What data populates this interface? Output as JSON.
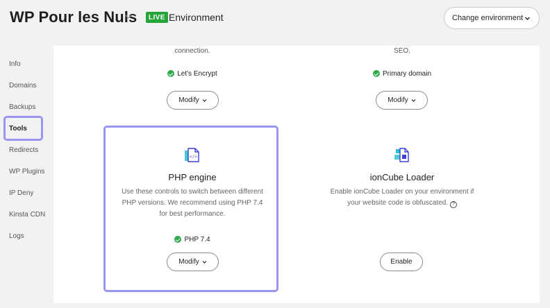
{
  "header": {
    "site_title": "WP Pour les Nuls",
    "live_badge": "LIVE",
    "environment_label": "Environment",
    "change_environment_label": "Change environment"
  },
  "sidebar": {
    "items": [
      {
        "label": "Info"
      },
      {
        "label": "Domains"
      },
      {
        "label": "Backups"
      },
      {
        "label": "Tools",
        "active": true
      },
      {
        "label": "Redirects"
      },
      {
        "label": "WP Plugins"
      },
      {
        "label": "IP Deny"
      },
      {
        "label": "Kinsta CDN"
      },
      {
        "label": "Logs"
      }
    ]
  },
  "tools": {
    "ssl": {
      "desc_tail": "connection.",
      "status": "Let's Encrypt",
      "button": "Modify"
    },
    "domain": {
      "desc_tail": "SEO.",
      "status": "Primary domain",
      "button": "Modify"
    },
    "php": {
      "icon": "php-engine-icon",
      "title": "PHP engine",
      "desc_lines": [
        "Use these controls to switch between different",
        "PHP versions. We recommend using PHP 7.4",
        "for best performance."
      ],
      "status": "PHP 7.4",
      "button": "Modify"
    },
    "ioncube": {
      "icon": "ioncube-icon",
      "title": "ionCube Loader",
      "desc_lines": [
        "Enable ionCube Loader on your environment if",
        "your website code is obfuscated."
      ],
      "button": "Enable"
    }
  },
  "colors": {
    "live_green": "#23a537",
    "check_green": "#2eaa4a",
    "highlight": "#9a95f3",
    "icon_blue": "#3b3fd8",
    "icon_teal": "#2bc0c8"
  }
}
